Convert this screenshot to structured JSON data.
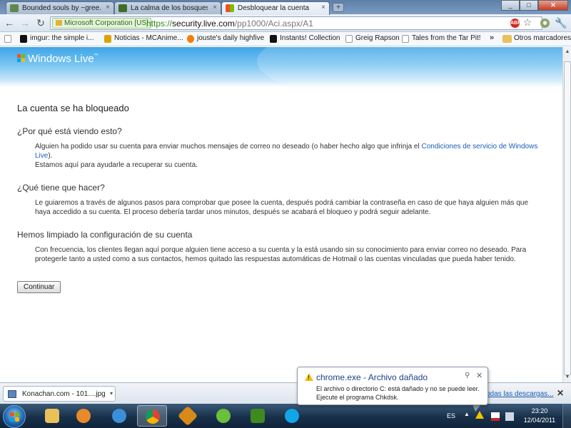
{
  "browser": {
    "tabs": [
      {
        "title": "Bounded souls by ~gree...",
        "favicon": "deviantart-icon",
        "active": false
      },
      {
        "title": "La calma de los bosques j...",
        "favicon": "image-icon",
        "active": false
      },
      {
        "title": "Desbloquear la cuenta",
        "favicon": "windows-live-icon",
        "active": true
      }
    ],
    "new_tab_label": "+",
    "address": {
      "security_badge": "Microsoft Corporation [US]",
      "scheme": "https://",
      "host": "security.live.com",
      "path": "/pp1000/Aci.aspx/A1"
    },
    "extensions": [
      "adblock-icon",
      "bookmark-star-icon",
      "extension-icon",
      "wrench-icon"
    ],
    "bookmarks": [
      {
        "label": "imgur: the simple i...",
        "icon": "imgur-icon"
      },
      {
        "label": "Noticias - MCAnime...",
        "icon": "mcanime-icon"
      },
      {
        "label": "jouste's daily highfive",
        "icon": "blogger-icon"
      },
      {
        "label": "Instants! Collection",
        "icon": "instants-icon"
      },
      {
        "label": "Greig Rapson",
        "icon": "page-icon"
      },
      {
        "label": "Tales from the Tar Pit!",
        "icon": "page-icon"
      }
    ],
    "bookmarks_overflow": "»",
    "other_bookmarks": "Otros marcadores"
  },
  "page": {
    "logo_text": "Windows Live",
    "logo_tm": "™",
    "heading": "La cuenta se ha bloqueado",
    "sections": [
      {
        "title": "¿Por qué está viendo esto?",
        "body_before_link": "Alguien ha podido usar su cuenta para enviar muchos mensajes de correo no deseado (o haber hecho algo que infrinja el ",
        "link": "Condiciones de servicio de Windows Live",
        "body_after_link": ").",
        "body2": "Estamos aquí para ayudarle a recuperar su cuenta."
      },
      {
        "title": "¿Qué tiene que hacer?",
        "body": "Le guiaremos a través de algunos pasos para comprobar que posee la cuenta, después podrá cambiar la contraseña en caso de que haya alguien más que haya accedido a su cuenta. El proceso debería tardar unos minutos, después se acabará el bloqueo y podrá seguir adelante."
      },
      {
        "title": "Hemos limpiado la configuración de su cuenta",
        "body": "Con frecuencia, los clientes llegan aquí porque alguien tiene acceso a su cuenta y la está usando sin su conocimiento para enviar correo no deseado. Para protegerle tanto a usted como a sus contactos, hemos quitado las respuestas automáticas de Hotmail o las cuentas vinculadas que pueda haber tenido."
      }
    ],
    "continue_button": "Continuar"
  },
  "downloads": {
    "item": "Konachan.com - 101....jpg",
    "show_all": "odas las descargas..."
  },
  "notification": {
    "title": "chrome.exe - Archivo dañado",
    "line1": "El archivo o directorio C: está dañado y no se puede leer.",
    "line2": "Ejecute el programa Chkdsk."
  },
  "taskbar": {
    "apps": [
      "windows-explorer-icon",
      "media-player-icon",
      "internet-explorer-icon",
      "chrome-icon",
      "winamp-icon",
      "messenger-icon",
      "qbittorrent-icon",
      "skype-icon"
    ],
    "language": "ES",
    "time": "23:20",
    "date": "12/04/2011"
  }
}
